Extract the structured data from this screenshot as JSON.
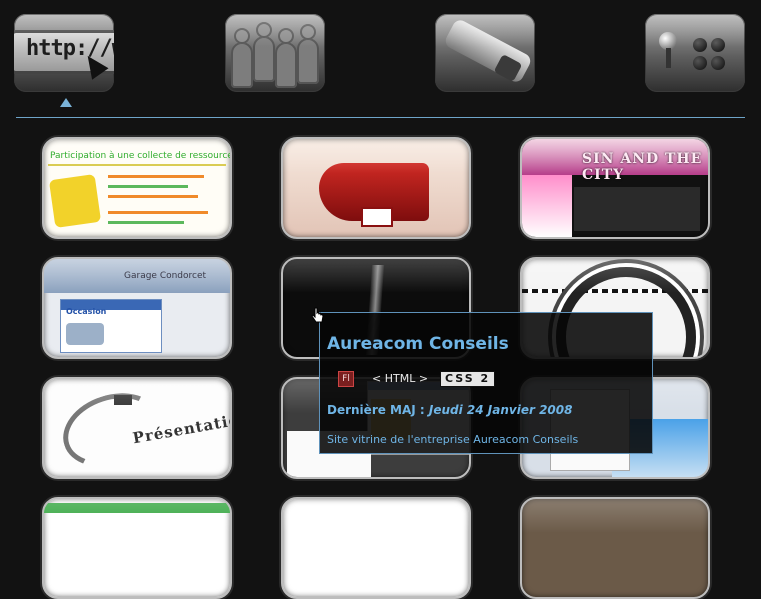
{
  "categories": [
    {
      "icon": "http-address-bar-icon",
      "url_text": "http://ww"
    },
    {
      "icon": "people-figures-icon"
    },
    {
      "icon": "paint-tube-icon"
    },
    {
      "icon": "arcade-joystick-icon"
    }
  ],
  "selected_category_index": 0,
  "colors": {
    "background": "#121212",
    "accent": "#6fb5e6",
    "divider": "#6ea4c8"
  },
  "thumbnails": [
    {
      "title": "Participation à une collecte de ressource"
    },
    {
      "title": "Aureacom Conseils"
    },
    {
      "title": "Sin and the City",
      "text": "SIN AND THE CITY"
    },
    {
      "title": "Garage Condorcet",
      "header": "Garage Condorcet",
      "section": "Occasion"
    },
    {
      "title": ""
    },
    {
      "title": ""
    },
    {
      "title": "",
      "text": "Présentation"
    },
    {
      "title": ""
    },
    {
      "title": ""
    },
    {
      "title": ""
    },
    {
      "title": ""
    },
    {
      "title": ""
    }
  ],
  "tooltip": {
    "title": "Aureacom Conseils",
    "tech_flash": "Fl",
    "tech_html": "< HTML >",
    "tech_css": "CSS 2",
    "maj_label": "Dernière MAJ :",
    "maj_date": "Jeudi 24 Janvier 2008",
    "description": "Site vitrine de l'entreprise Aureacom Conseils"
  }
}
